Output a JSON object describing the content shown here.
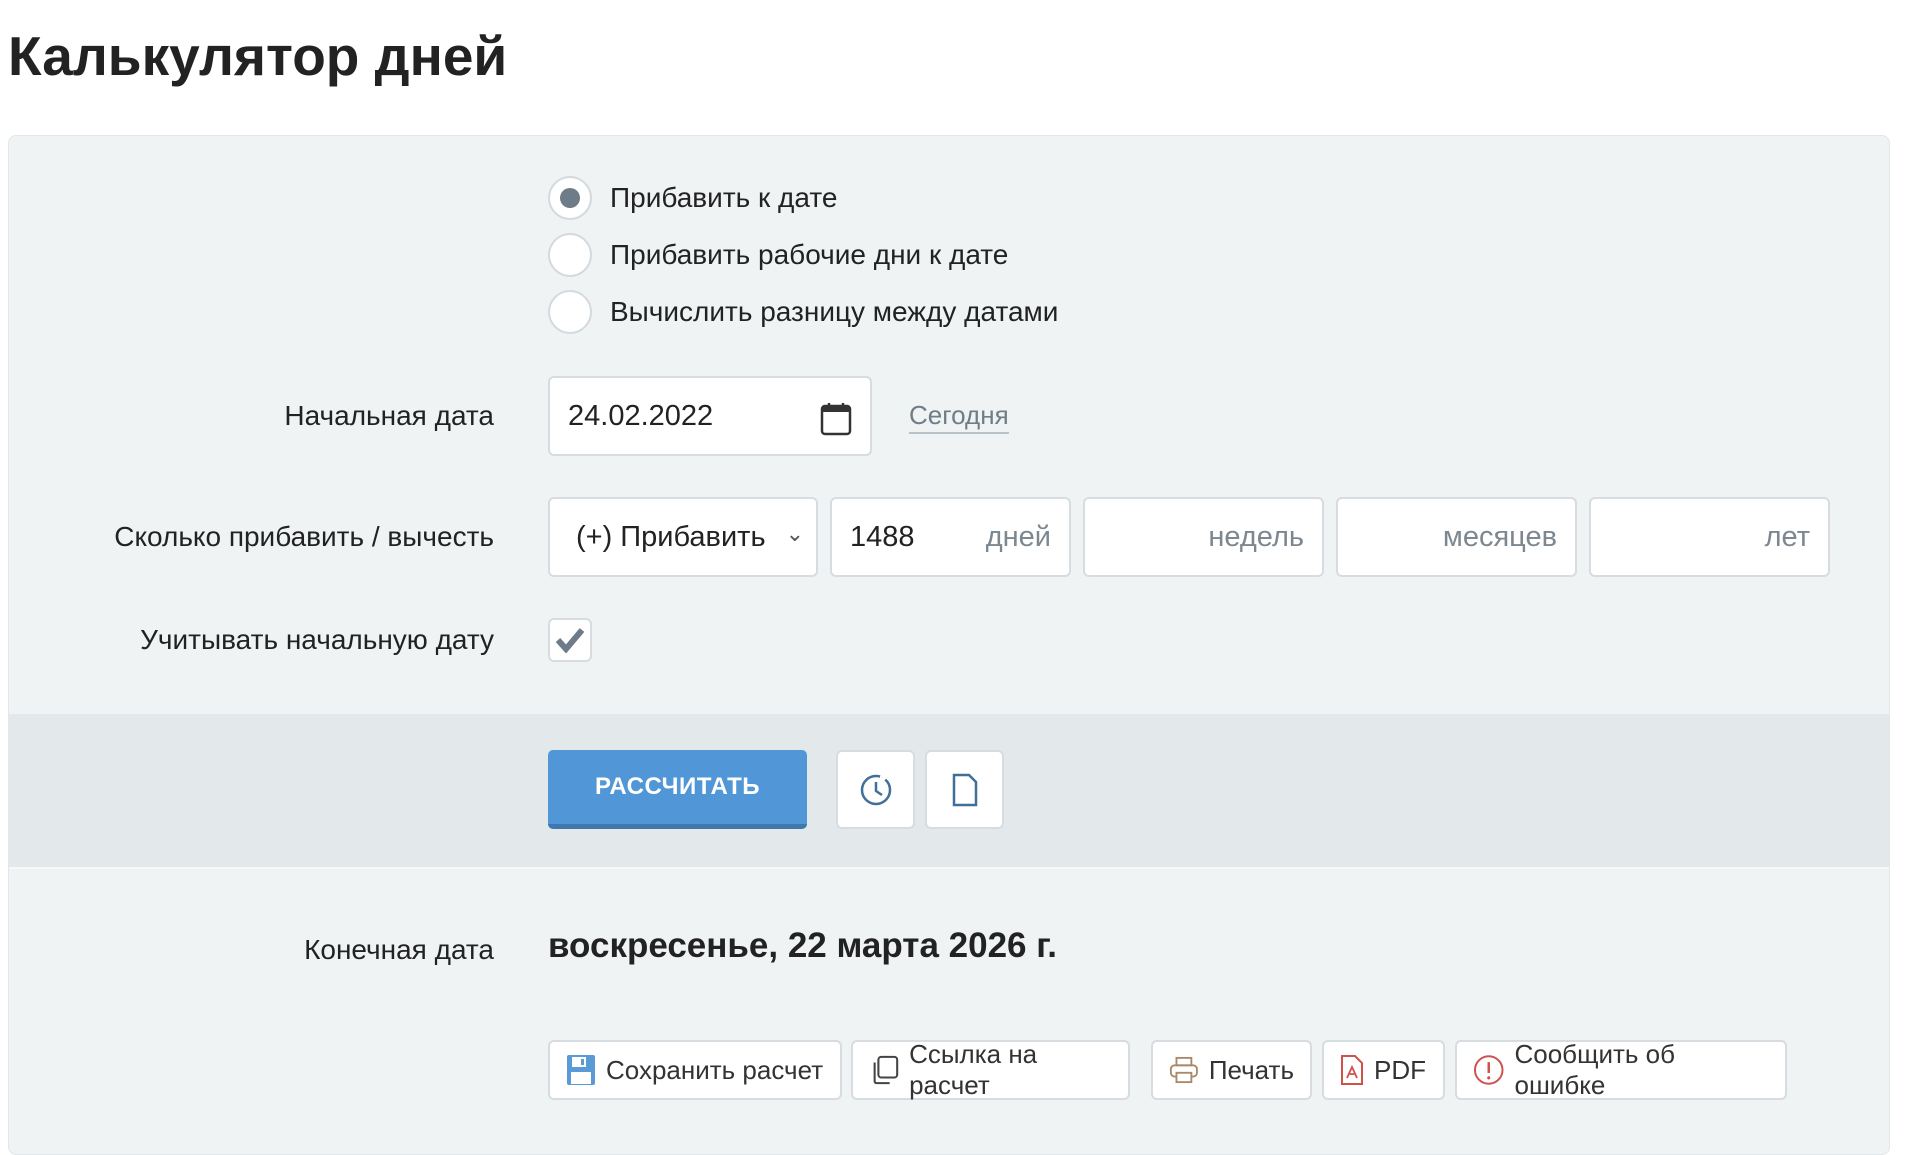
{
  "title": "Калькулятор дней",
  "modes": [
    {
      "label": "Прибавить к дате",
      "selected": true
    },
    {
      "label": "Прибавить рабочие дни к дате",
      "selected": false
    },
    {
      "label": "Вычислить разницу между датами",
      "selected": false
    }
  ],
  "start_date": {
    "label": "Начальная дата",
    "value": "24.02.2022",
    "today_link": "Сегодня"
  },
  "amount": {
    "label": "Сколько прибавить / вычесть",
    "operation": "(+) Прибавить",
    "days": "1488",
    "days_unit": "дней",
    "weeks_unit": "недель",
    "months_unit": "месяцев",
    "years_unit": "лет"
  },
  "include_start": {
    "label": "Учитывать начальную дату",
    "checked": true
  },
  "calculate_label": "РАССЧИТАТЬ",
  "result": {
    "label": "Конечная дата",
    "value": "воскресенье, 22 марта 2026 г."
  },
  "actions": {
    "save": "Сохранить расчет",
    "link": "Ссылка на расчет",
    "print": "Печать",
    "pdf": "PDF",
    "report": "Сообщить об ошибке"
  },
  "colors": {
    "primary": "#5196d6",
    "panel": "#eff3f4"
  }
}
